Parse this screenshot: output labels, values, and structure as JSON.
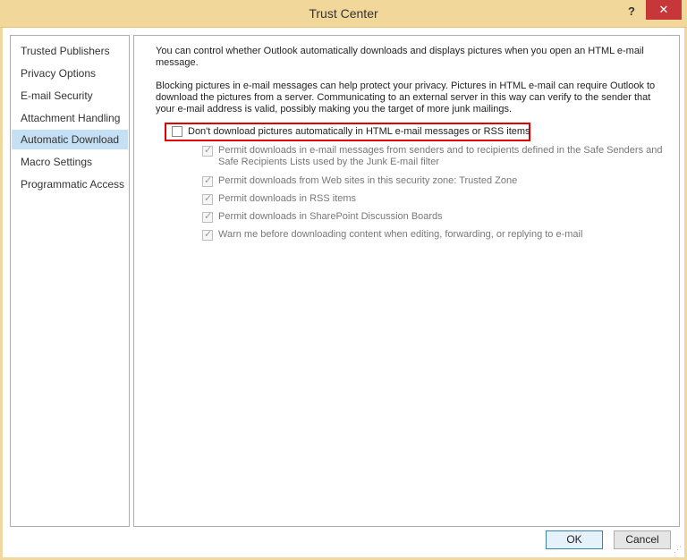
{
  "window": {
    "title": "Trust Center",
    "help_label": "?",
    "close_label": "✕"
  },
  "sidebar": {
    "items": [
      {
        "label": "Trusted Publishers"
      },
      {
        "label": "Privacy Options"
      },
      {
        "label": "E-mail Security"
      },
      {
        "label": "Attachment Handling"
      },
      {
        "label": "Automatic Download",
        "selected": true
      },
      {
        "label": "Macro Settings"
      },
      {
        "label": "Programmatic Access"
      }
    ]
  },
  "content": {
    "intro1": "You can control whether Outlook automatically downloads and displays pictures when you open an HTML e-mail message.",
    "intro2": "Blocking pictures in e-mail messages can help protect your privacy. Pictures in HTML e-mail can require Outlook to download the pictures from a server. Communicating to an external server in this way can verify to the sender that your e-mail address is valid, possibly making you the target of more junk mailings.",
    "main_option": {
      "label": "Don't download pictures automatically in HTML e-mail messages or RSS items",
      "checked": false
    },
    "sub_options": [
      {
        "label": "Permit downloads in e-mail messages from senders and to recipients defined in the Safe Senders and Safe Recipients Lists used by the Junk E-mail filter",
        "checked": true
      },
      {
        "label": "Permit downloads from Web sites in this security zone: Trusted Zone",
        "checked": true
      },
      {
        "label": "Permit downloads in RSS items",
        "checked": true
      },
      {
        "label": "Permit downloads in SharePoint Discussion Boards",
        "checked": true
      },
      {
        "label": "Warn me before downloading content when editing, forwarding, or replying to e-mail",
        "checked": true
      }
    ]
  },
  "buttons": {
    "ok": "OK",
    "cancel": "Cancel"
  }
}
